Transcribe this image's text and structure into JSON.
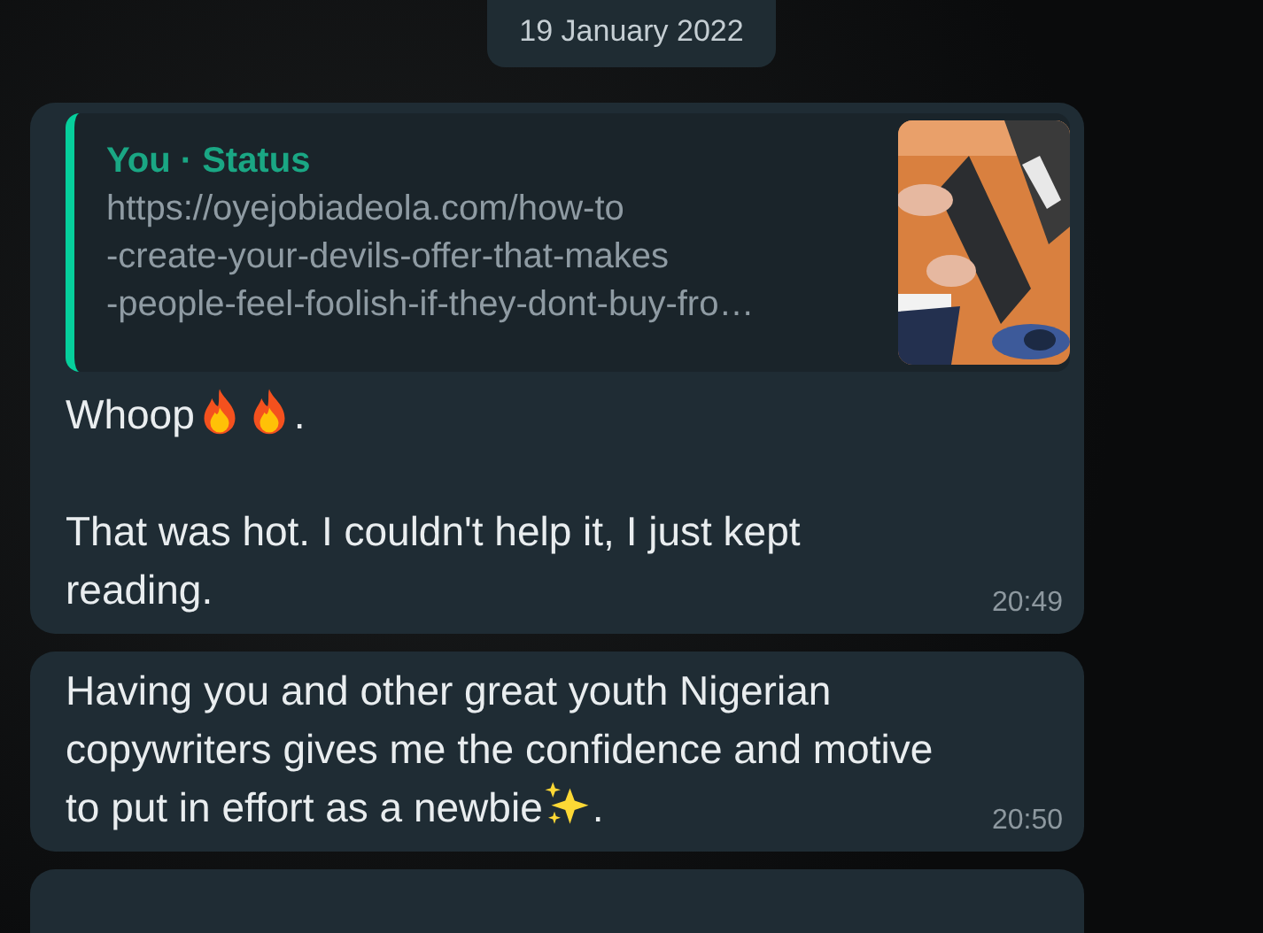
{
  "date_chip": "19 January 2022",
  "messages": [
    {
      "quote": {
        "author": "You · Status",
        "link_lines": [
          "https://oyejobiadeola.com/how-to",
          "-create-your-devils-offer-that-makes",
          "-people-feel-foolish-if-they-dont-buy-fro…"
        ],
        "kind": "picture"
      },
      "paragraphs": [
        [
          {
            "kind": "text",
            "text": "Whoop"
          },
          {
            "kind": "fire"
          },
          {
            "kind": "fire"
          },
          {
            "kind": "text",
            "text": "."
          }
        ],
        [
          {
            "kind": "text",
            "text": "That was hot. I couldn't help it, I just kept reading."
          }
        ]
      ],
      "time": "20:49"
    },
    {
      "paragraphs": [
        [
          {
            "kind": "text",
            "text": "Having you and other great youth Nigerian copywriters gives me the confidence and motive to put in effort as a newbie"
          },
          {
            "kind": "sparkles"
          },
          {
            "kind": "text",
            "text": "."
          }
        ]
      ],
      "time": "20:50"
    }
  ]
}
